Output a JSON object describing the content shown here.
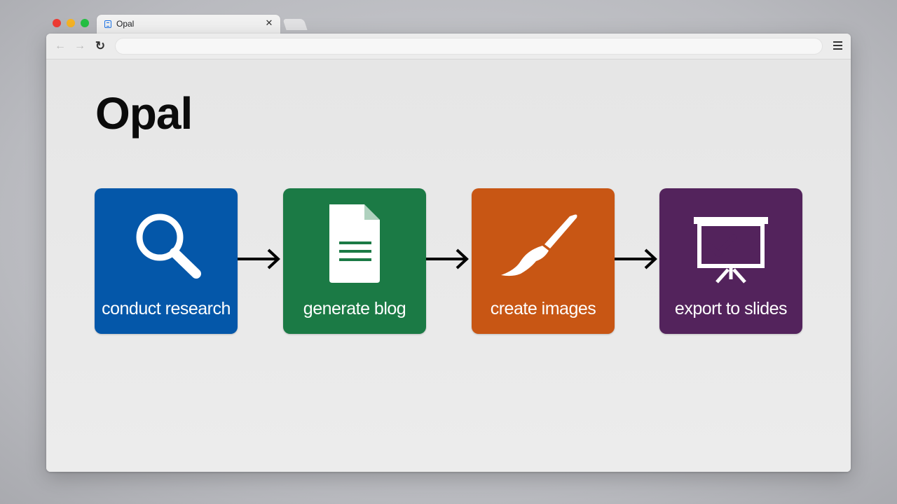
{
  "browser": {
    "tab": {
      "title": "Opal",
      "close_icon": "close-icon",
      "favicon": "doc-icon"
    },
    "toolbar": {
      "back_icon": "back-arrow-icon",
      "forward_icon": "forward-arrow-icon",
      "reload_icon": "reload-icon",
      "address_value": "",
      "menu_icon": "hamburger-menu-icon"
    }
  },
  "page": {
    "title": "Opal",
    "workflow": [
      {
        "label": "conduct research",
        "icon": "magnifier-icon",
        "color": "#0457a9"
      },
      {
        "label": "generate blog",
        "icon": "document-icon",
        "color": "#1b7a45"
      },
      {
        "label": "create images",
        "icon": "paintbrush-icon",
        "color": "#c85614"
      },
      {
        "label": "export to slides",
        "icon": "presentation-icon",
        "color": "#53235c"
      }
    ]
  },
  "colors": {
    "traffic_red": "#ee3b33",
    "traffic_yellow": "#f5b324",
    "traffic_green": "#23c043",
    "arrow": "#000000"
  }
}
